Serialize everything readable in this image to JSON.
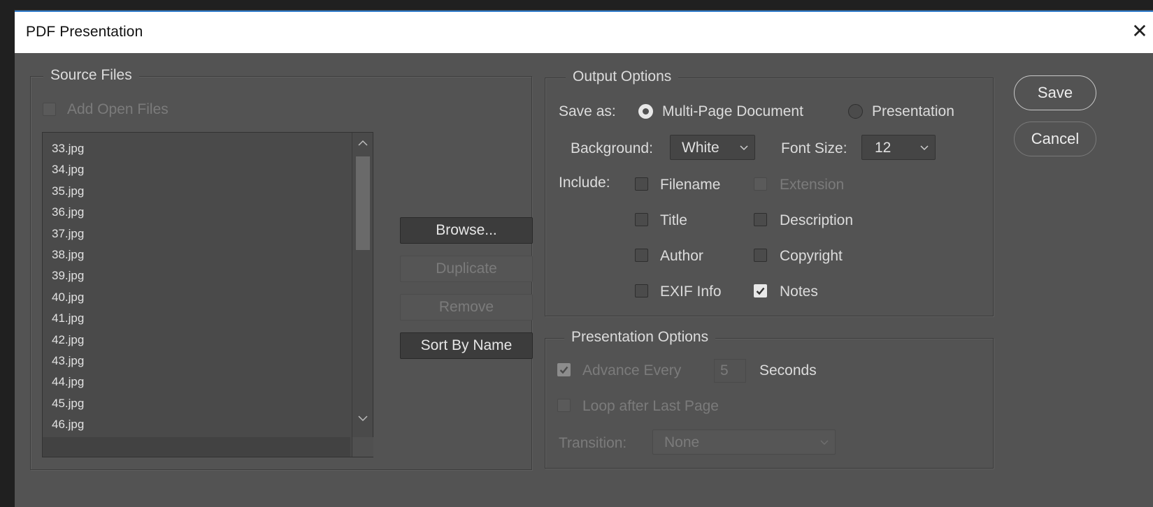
{
  "window": {
    "title": "PDF Presentation"
  },
  "source_files": {
    "title": "Source Files",
    "add_open_files": {
      "label": "Add Open Files",
      "checked": false,
      "enabled": false
    },
    "files": [
      "33.jpg",
      "34.jpg",
      "35.jpg",
      "36.jpg",
      "37.jpg",
      "38.jpg",
      "39.jpg",
      "40.jpg",
      "41.jpg",
      "42.jpg",
      "43.jpg",
      "44.jpg",
      "45.jpg",
      "46.jpg"
    ],
    "buttons": {
      "browse": "Browse...",
      "duplicate": "Duplicate",
      "remove": "Remove",
      "sort": "Sort By Name"
    }
  },
  "output_options": {
    "title": "Output Options",
    "save_as_label": "Save as:",
    "save_as_options": [
      "Multi-Page Document",
      "Presentation"
    ],
    "save_as_selected": "Multi-Page Document",
    "background_label": "Background:",
    "background_value": "White",
    "font_size_label": "Font Size:",
    "font_size_value": "12",
    "include_label": "Include:",
    "include": {
      "filename": {
        "label": "Filename",
        "checked": false
      },
      "extension": {
        "label": "Extension",
        "checked": false,
        "enabled": false
      },
      "title": {
        "label": "Title",
        "checked": false
      },
      "description": {
        "label": "Description",
        "checked": false
      },
      "author": {
        "label": "Author",
        "checked": false
      },
      "copyright": {
        "label": "Copyright",
        "checked": false
      },
      "exif": {
        "label": "EXIF Info",
        "checked": false
      },
      "notes": {
        "label": "Notes",
        "checked": true
      }
    }
  },
  "presentation_options": {
    "title": "Presentation Options",
    "advance_every_label": "Advance Every",
    "advance_every_checked": true,
    "advance_seconds": "5",
    "seconds_label": "Seconds",
    "loop_label": "Loop after Last Page",
    "loop_checked": false,
    "transition_label": "Transition:",
    "transition_value": "None"
  },
  "actions": {
    "save": "Save",
    "cancel": "Cancel"
  },
  "colors": {
    "dialog_bg": "#535353",
    "title_accent": "#2b78c8"
  }
}
